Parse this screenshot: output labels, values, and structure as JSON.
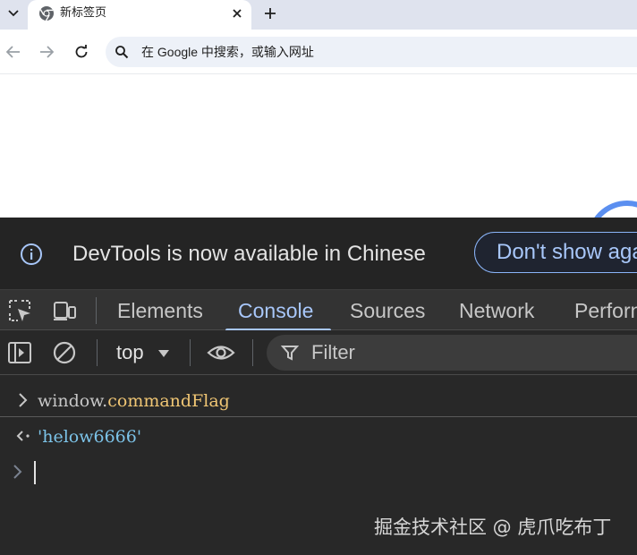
{
  "browser": {
    "tab": {
      "title": "新标签页"
    },
    "omnibox": {
      "placeholder": "在 Google 中搜索，或输入网址"
    }
  },
  "devtools": {
    "infobar": {
      "message": "DevTools is now available in Chinese",
      "dismiss_label": "Don't show aga"
    },
    "panel_tabs": [
      {
        "label": "Elements",
        "active": false
      },
      {
        "label": "Console",
        "active": true
      },
      {
        "label": "Sources",
        "active": false
      },
      {
        "label": "Network",
        "active": false
      },
      {
        "label": "Perforn",
        "active": false
      }
    ],
    "console_toolbar": {
      "context": "top",
      "filter_placeholder": "Filter"
    },
    "console": {
      "input_object": "window.",
      "input_property": "commandFlag",
      "result": "'helow6666'"
    }
  },
  "watermark": "掘金技术社区 @ 虎爪吃布丁",
  "colors": {
    "accent": "#a8c7fa",
    "devtools_bg": "#282828",
    "property": "#f0c674",
    "string": "#7cc3e8"
  }
}
